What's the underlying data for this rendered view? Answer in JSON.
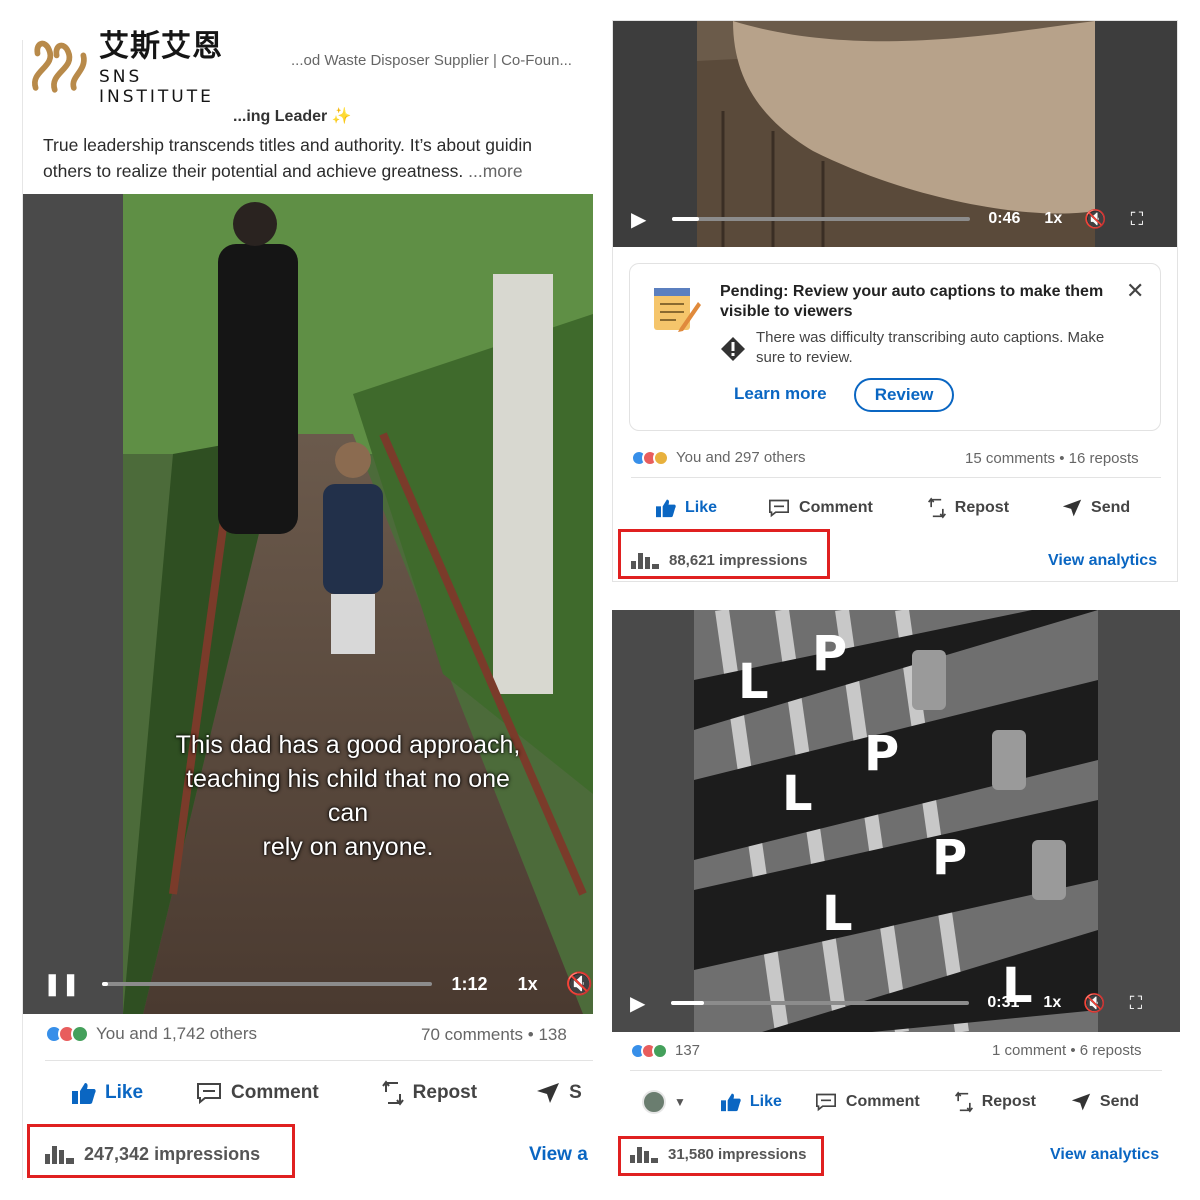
{
  "brand": {
    "name_cn": "艾斯艾恩",
    "name_en": "SNS INSTITUTE",
    "color": "#b88a4a"
  },
  "left_post": {
    "author_line": "...od Waste Disposer Supplier | Co-Foun...",
    "heading": "...ing Leader",
    "body_line1": "True leadership transcends titles and authority. It’s about guidin",
    "body_line2": "others to realize their potential and achieve greatness.",
    "more": "...more",
    "video": {
      "caption_line1": "This dad has a good approach,",
      "caption_line2": "teaching his child that no one can",
      "caption_line3": "rely on anyone.",
      "time": "1:12",
      "speed": "1x",
      "progress": 0.02,
      "play_state_icon": "pause-icon"
    },
    "reactions_text": "You and 1,742 others",
    "counts_text": "70 comments • 138",
    "actions": {
      "like": "Like",
      "comment": "Comment",
      "repost": "Repost",
      "send": "S"
    },
    "impressions": "247,342 impressions",
    "analytics": "View a"
  },
  "top_right_post": {
    "video": {
      "time": "0:46",
      "speed": "1x",
      "progress": 0.09
    },
    "caption_notice": {
      "title": "Pending: Review your auto captions to make them visible to viewers",
      "message": "There was difficulty transcribing auto captions. Make sure to review.",
      "learn_more": "Learn more",
      "review": "Review"
    },
    "reactions_text": "You and 297 others",
    "counts_text": "15 comments • 16 reposts",
    "actions": {
      "like": "Like",
      "comment": "Comment",
      "repost": "Repost",
      "send": "Send"
    },
    "impressions": "88,621 impressions",
    "analytics": "View analytics"
  },
  "bottom_right_post": {
    "video": {
      "time": "0:31",
      "speed": "1x",
      "progress": 0.11,
      "belt_letters": [
        "L",
        "P"
      ]
    },
    "reactions_text": "137",
    "counts_text": "1 comment • 6 reposts",
    "actions": {
      "like": "Like",
      "comment": "Comment",
      "repost": "Repost",
      "send": "Send"
    },
    "impressions": "31,580 impressions",
    "analytics": "View analytics"
  },
  "colors": {
    "link_blue": "#0a66c2",
    "highlight_red": "#e02020",
    "text_gray": "#666666"
  }
}
